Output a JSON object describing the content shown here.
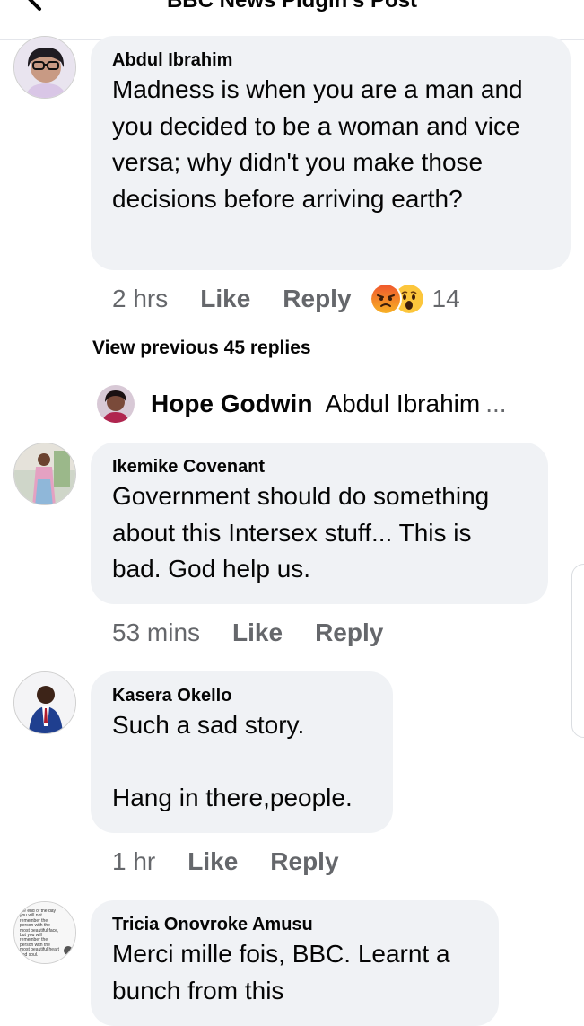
{
  "header": {
    "title": "BBC News Pidgin's Post"
  },
  "comments": [
    {
      "author": "Abdul Ibrahim",
      "text": "Madness is when you are a man and you decided to be a woman and vice versa; why didn't you make those decisions before arriving earth?",
      "time": "2 hrs",
      "like": "Like",
      "reply": "Reply",
      "reaction_count": "14",
      "reactions": [
        "angry",
        "wow"
      ]
    },
    {
      "author": "Ikemike Covenant",
      "text": "Government should do something about this Intersex stuff... This is bad. God help us.",
      "time": "53 mins",
      "like": "Like",
      "reply": "Reply"
    },
    {
      "author": "Kasera Okello",
      "text": "Such a sad story.\n\nHang in there,people.",
      "time": "1 hr",
      "like": "Like",
      "reply": "Reply"
    },
    {
      "author": "Tricia Onovroke Amusu",
      "text": "Merci mille fois, BBC. Learnt a bunch from this"
    }
  ],
  "view_previous": "View previous 45 replies",
  "reply_preview": {
    "name": "Hope Godwin",
    "text": "Abdul Ibrahim",
    "ellipsis": "..."
  },
  "avatar_quote": "the end of the day you will not remember the person with the most beautiful face, but you will remember the person with the most beautiful heart and soul.",
  "colors": {
    "bubble": "#f0f2f5",
    "secondary_text": "#65676b",
    "primary_text": "#050505"
  }
}
